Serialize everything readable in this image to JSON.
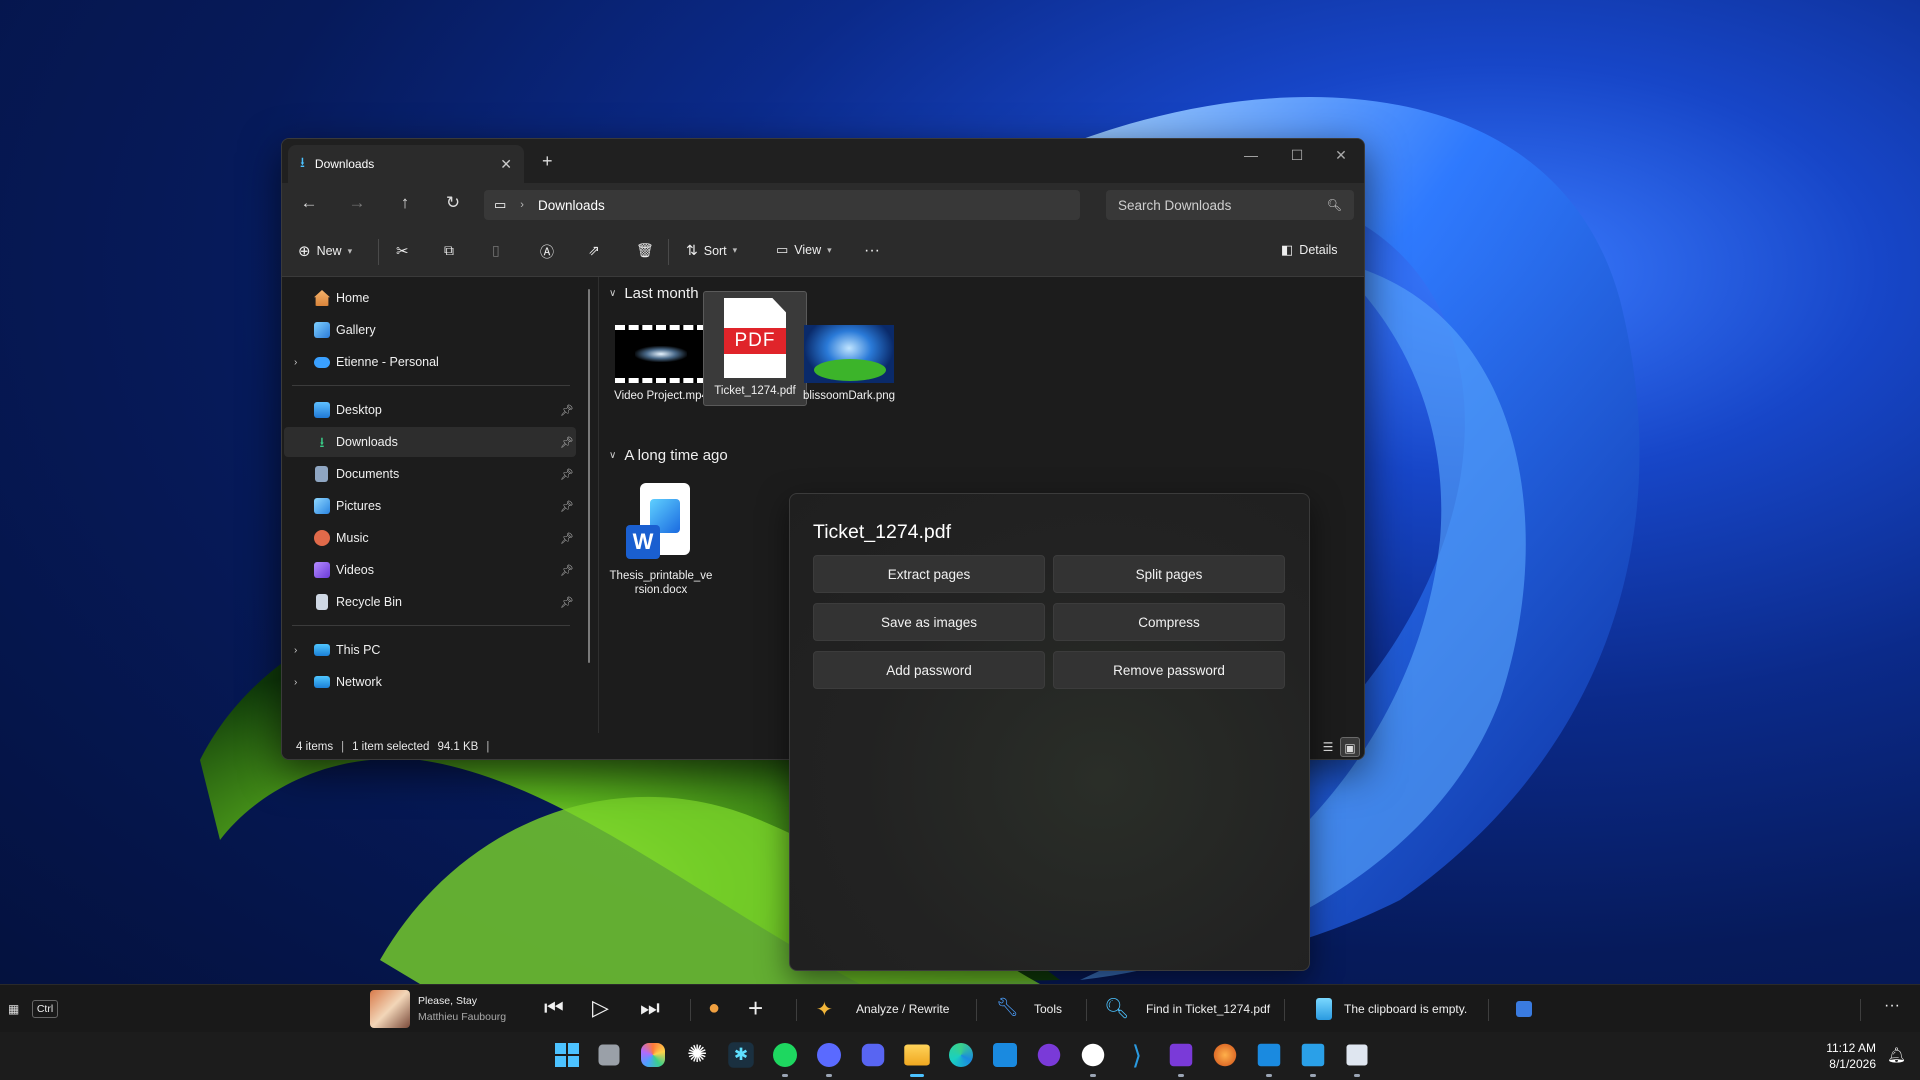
{
  "explorer": {
    "tab_title": "Downloads",
    "address": "Downloads",
    "search_placeholder": "Search Downloads",
    "commands": {
      "new": "New",
      "sort": "Sort",
      "view": "View",
      "details": "Details"
    },
    "sidebar": {
      "home": "Home",
      "gallery": "Gallery",
      "onedrive": "Etienne - Personal",
      "desktop": "Desktop",
      "downloads": "Downloads",
      "documents": "Documents",
      "pictures": "Pictures",
      "music": "Music",
      "videos": "Videos",
      "recycle": "Recycle Bin",
      "thispc": "This PC",
      "network": "Network"
    },
    "groups": {
      "last_month": "Last month",
      "long_ago": "A long time ago"
    },
    "files": {
      "video": "Video Project.mp4",
      "pdf": "Ticket_1274.pdf",
      "png": "blissoomDark.png",
      "docx": "Thesis_printable_version.docx",
      "pdf_badge": "PDF"
    },
    "status": {
      "items": "4 items",
      "selected": "1 item selected",
      "size": "94.1 KB"
    }
  },
  "popup": {
    "title": "Ticket_1274.pdf",
    "buttons": {
      "extract": "Extract pages",
      "split": "Split pages",
      "save_images": "Save as images",
      "compress": "Compress",
      "add_password": "Add password",
      "remove_password": "Remove password"
    }
  },
  "strip": {
    "ctrl": "Ctrl",
    "song_title": "Please, Stay",
    "song_artist": "Matthieu Faubourg",
    "analyze": "Analyze / Rewrite",
    "tools": "Tools",
    "find": "Find in Ticket_1274.pdf",
    "clipboard": "The clipboard is empty."
  },
  "taskbar": {
    "time": "11:12 AM",
    "date": "8/1/2026"
  },
  "colors": {
    "accent": "#4cc2ff",
    "window_bg": "#1c1c1c",
    "pdf_red": "#e0242a"
  }
}
